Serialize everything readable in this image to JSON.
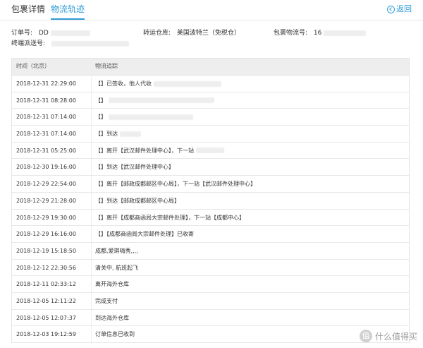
{
  "tabs": [
    {
      "label": "包裹详情"
    },
    {
      "label": "物流轨迹"
    }
  ],
  "back_label": "返回",
  "info": {
    "order_label": "订单号:",
    "order_value": "DD",
    "warehouse_label": "转运仓库:",
    "warehouse_value": "美国波特兰（免税仓）",
    "package_label": "包裹物流号:",
    "package_value": "16",
    "final_label": "终端派送号:"
  },
  "table": {
    "headers": [
      "时间（北京）",
      "物流追踪"
    ],
    "rows": [
      {
        "time": "2018-12-31 22:29:00",
        "trace": "【】已签收，他人代收"
      },
      {
        "time": "2018-12-31 08:28:00",
        "trace": "【】"
      },
      {
        "time": "2018-12-31 07:14:00",
        "trace": "【】"
      },
      {
        "time": "2018-12-31 07:14:00",
        "trace": "【】到达"
      },
      {
        "time": "2018-12-31 05:25:00",
        "trace": "【】离开【武汉邮件处理中心】，下一站"
      },
      {
        "time": "2018-12-30 19:16:00",
        "trace": "【】到达【武汉邮件处理中心】"
      },
      {
        "time": "2018-12-29 22:54:00",
        "trace": "【】离开【邮政成都邮区中心局】，下一站【武汉邮件处理中心】"
      },
      {
        "time": "2018-12-29 21:28:00",
        "trace": "【】到达【邮政成都邮区中心局】"
      },
      {
        "time": "2018-12-29 19:30:00",
        "trace": "【】离开【成都商函局大宗邮件处理】，下一站【成都中心】"
      },
      {
        "time": "2018-12-29 16:16:00",
        "trace": "【】【成都商函局大宗邮件处理】已收寄"
      },
      {
        "time": "2018-12-19 15:18:50",
        "trace": "成都,爱琪嗨秀,,,,"
      },
      {
        "time": "2018-12-12 22:30:56",
        "trace": "清关中, 航班起飞"
      },
      {
        "time": "2018-12-11 02:33:12",
        "trace": "离开海外仓库"
      },
      {
        "time": "2018-12-05 12:11:22",
        "trace": "完成支付"
      },
      {
        "time": "2018-12-05 12:07:37",
        "trace": "到达海外仓库"
      },
      {
        "time": "2018-12-03 19:12:59",
        "trace": "订单信息已收到"
      }
    ]
  },
  "watermark": {
    "icon": "值",
    "text": "什么值得买"
  }
}
